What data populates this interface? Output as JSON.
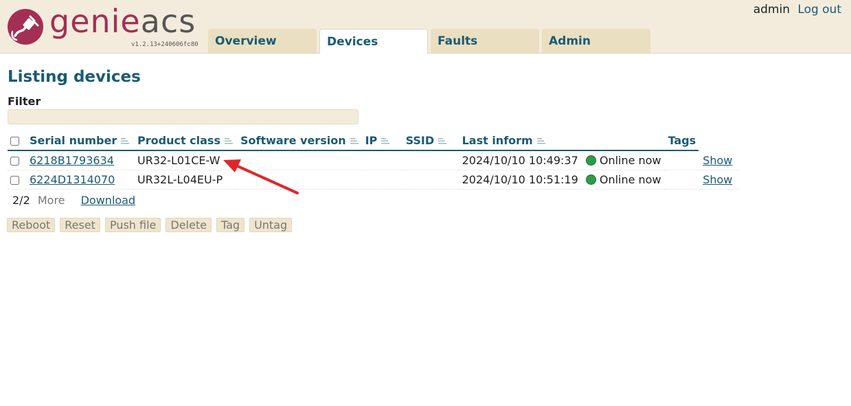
{
  "header": {
    "logo": {
      "part1": "genie",
      "part2": "acs",
      "version": "v1.2.13+240606fc80"
    },
    "tabs": [
      {
        "label": "Overview",
        "active": false
      },
      {
        "label": "Devices",
        "active": true
      },
      {
        "label": "Faults",
        "active": false
      },
      {
        "label": "Admin",
        "active": false
      }
    ],
    "user": "admin",
    "logout_label": "Log out"
  },
  "page": {
    "title": "Listing devices",
    "filter_label": "Filter",
    "filter_value": ""
  },
  "table": {
    "columns": [
      {
        "label": "Serial number",
        "sortable": true
      },
      {
        "label": "Product class",
        "sortable": true
      },
      {
        "label": "Software version",
        "sortable": true
      },
      {
        "label": "IP",
        "sortable": true
      },
      {
        "label": "SSID",
        "sortable": true
      },
      {
        "label": "Last inform",
        "sortable": true
      },
      {
        "label": "Tags",
        "sortable": false
      }
    ],
    "rows": [
      {
        "serial": "6218B1793634",
        "product_class": "UR32-L01CE-W",
        "software_version": "",
        "ip": "",
        "ssid": "",
        "last_inform": "2024/10/10 10:49:37",
        "status": "Online now",
        "tags": "",
        "show_label": "Show"
      },
      {
        "serial": "6224D1314070",
        "product_class": "UR32L-L04EU-P",
        "software_version": "",
        "ip": "",
        "ssid": "",
        "last_inform": "2024/10/10 10:51:19",
        "status": "Online now",
        "tags": "",
        "show_label": "Show"
      }
    ],
    "pager": {
      "count": "2/2",
      "more_label": "More",
      "download_label": "Download"
    }
  },
  "actions": [
    {
      "label": "Reboot"
    },
    {
      "label": "Reset"
    },
    {
      "label": "Push file"
    },
    {
      "label": "Delete"
    },
    {
      "label": "Tag"
    },
    {
      "label": "Untag"
    }
  ],
  "colors": {
    "header_bg": "#f3ecdc",
    "accent": "#1b5a74",
    "brand": "#a32f55",
    "online": "#2f9b48",
    "annotation_arrow": "#e0262b"
  }
}
